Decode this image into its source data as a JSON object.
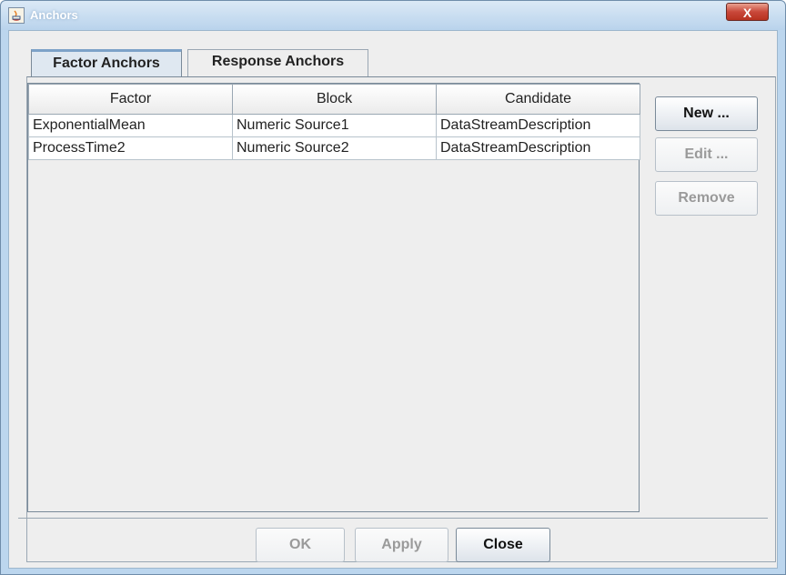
{
  "window": {
    "title": "Anchors",
    "close_glyph": "X"
  },
  "tabs": [
    {
      "label": "Factor Anchors",
      "active": true
    },
    {
      "label": "Response Anchors",
      "active": false
    }
  ],
  "table": {
    "headers": [
      "Factor",
      "Block",
      "Candidate"
    ],
    "rows": [
      [
        "ExponentialMean",
        "Numeric Source1",
        "DataStreamDescription"
      ],
      [
        "ProcessTime2",
        "Numeric Source2",
        "DataStreamDescription"
      ]
    ]
  },
  "side_buttons": {
    "new_label": "New ...",
    "edit_label": "Edit ...",
    "remove_label": "Remove"
  },
  "dialog_buttons": {
    "ok_label": "OK",
    "apply_label": "Apply",
    "close_label": "Close"
  }
}
